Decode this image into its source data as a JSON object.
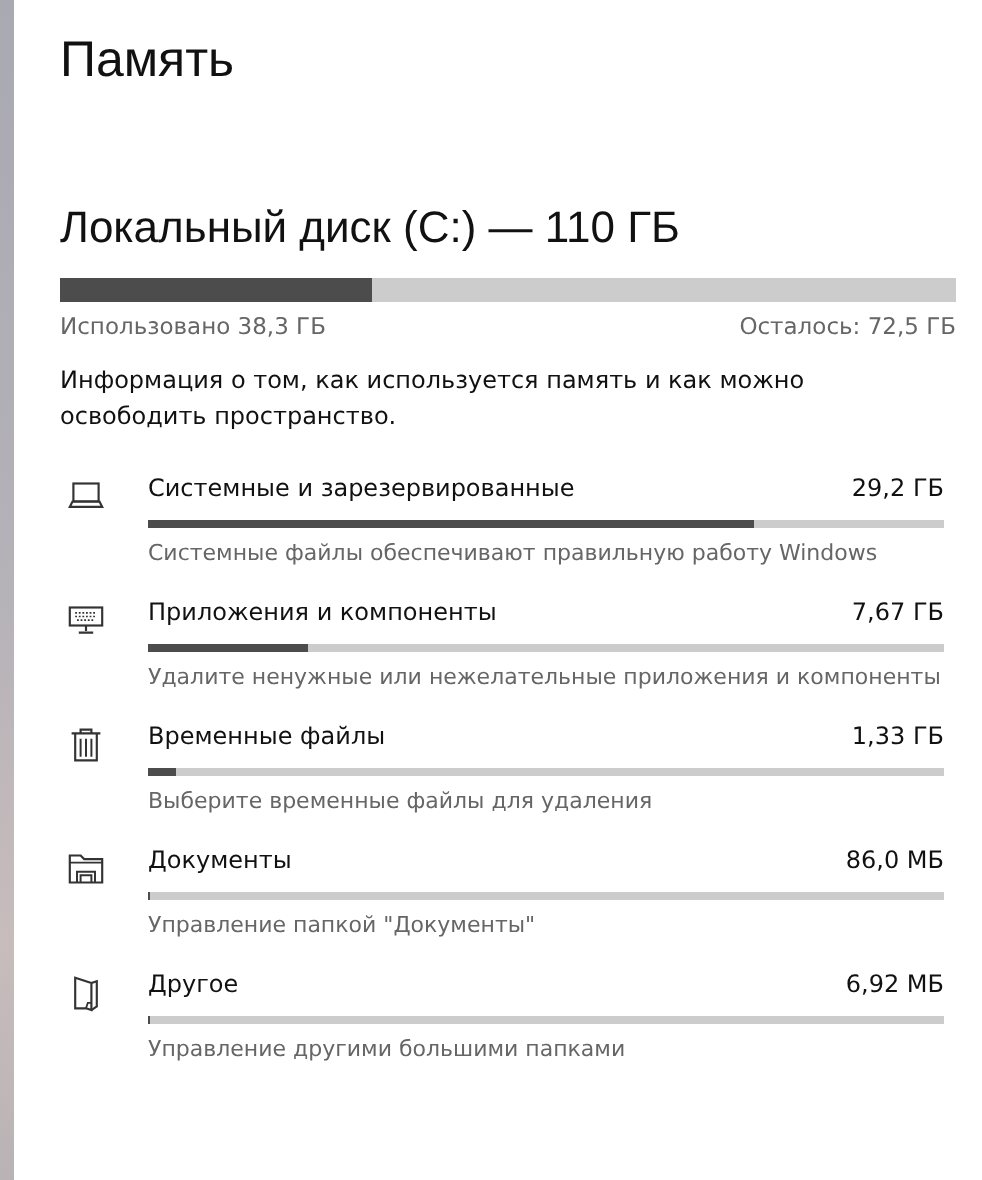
{
  "title": "Память",
  "drive": {
    "name": "Локальный диск (C:) — 110 ГБ",
    "level": 0.348,
    "used": "Использовано 38,3 ГБ",
    "free": "Осталось: 72,5 ГБ"
  },
  "info": "Информация о том, как используется память и как можно освободить пространство.",
  "categories": [
    {
      "kind": "laptop",
      "name": "Системные и зарезервированные",
      "size": "29,2 ГБ",
      "level": 0.762,
      "description": "Системные файлы обеспечивают правильную работу Windows"
    },
    {
      "kind": "keyboard",
      "name": "Приложения и компоненты",
      "size": "7,67 ГБ",
      "level": 0.2,
      "description": "Удалите ненужные или нежелательные приложения и компоненты"
    },
    {
      "kind": "trash",
      "name": "Временные файлы",
      "size": "1,33 ГБ",
      "level": 0.035,
      "description": "Выберите временные файлы для удаления"
    },
    {
      "kind": "folder",
      "name": "Документы",
      "size": "86,0 МБ",
      "level": 0.003,
      "description": "Управление папкой \"Документы\""
    },
    {
      "kind": "page",
      "name": "Другое",
      "size": "6,92 МБ",
      "level": 0,
      "description": "Управление другими большими папками"
    }
  ]
}
